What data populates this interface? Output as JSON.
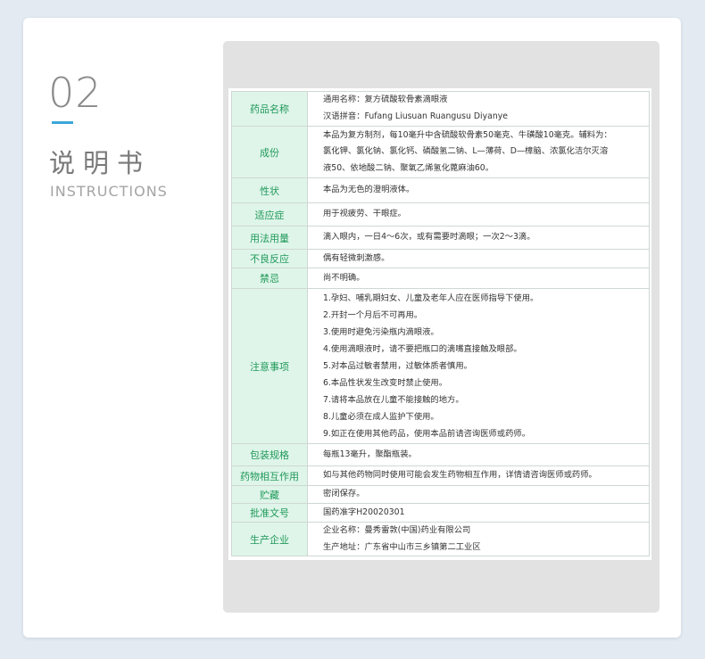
{
  "header": {
    "number": "02",
    "title_cn": "说明书",
    "title_en": "INSTRUCTIONS"
  },
  "rows": [
    {
      "label": "药品名称",
      "lines": [
        "通用名称：复方硫酸软骨素滴眼液",
        "汉语拼音：Fufang Liusuan Ruangusu Diyanye"
      ]
    },
    {
      "label": "成份",
      "lines": [
        "本品为复方制剂，每10毫升中含硫酸软骨素50毫克、牛磺酸10毫克。辅料为：",
        "氯化钾、氯化钠、氯化钙、磷酸氢二钠、L—薄荷、D—樟脑、浓氯化洁尔灭溶",
        "液50、依地酸二钠、聚氧乙烯氢化蓖麻油60。"
      ]
    },
    {
      "label": "性状",
      "lines": [
        "本品为无色的澄明液体。"
      ]
    },
    {
      "label": "适应症",
      "lines": [
        "用于视疲劳、干眼症。"
      ]
    },
    {
      "label": "用法用量",
      "lines": [
        "滴入眼内，一日4～6次，或有需要时滴眼；一次2～3滴。"
      ]
    },
    {
      "label": "不良反应",
      "lines": [
        "偶有轻微刺激感。"
      ]
    },
    {
      "label": "禁忌",
      "lines": [
        "尚不明确。"
      ]
    },
    {
      "label": "注意事项",
      "lines": [
        "1.孕妇、哺乳期妇女、儿童及老年人应在医师指导下使用。",
        "2.开封一个月后不可再用。",
        "3.使用时避免污染瓶内滴眼液。",
        "4.使用滴眼液时，请不要把瓶口的滴嘴直接触及眼部。",
        "5.对本品过敏者禁用，过敏体质者慎用。",
        "6.本品性状发生改变时禁止使用。",
        "7.请将本品放在儿童不能接触的地方。",
        "8.儿童必须在成人监护下使用。",
        "9.如正在使用其他药品，使用本品前请咨询医师或药师。"
      ]
    },
    {
      "label": "包装规格",
      "lines": [
        "每瓶13毫升，聚酯瓶装。"
      ]
    },
    {
      "label": "药物相互作用",
      "lines": [
        "如与其他药物同时使用可能会发生药物相互作用，详情请咨询医师或药师。"
      ]
    },
    {
      "label": "贮藏",
      "lines": [
        "密闭保存。"
      ]
    },
    {
      "label": "批准文号",
      "lines": [
        "国药准字H20020301"
      ]
    },
    {
      "label": "生产企业",
      "lines": [
        "企业名称：曼秀雷敦(中国)药业有限公司",
        "生产地址：广东省中山市三乡镇第二工业区"
      ]
    }
  ]
}
